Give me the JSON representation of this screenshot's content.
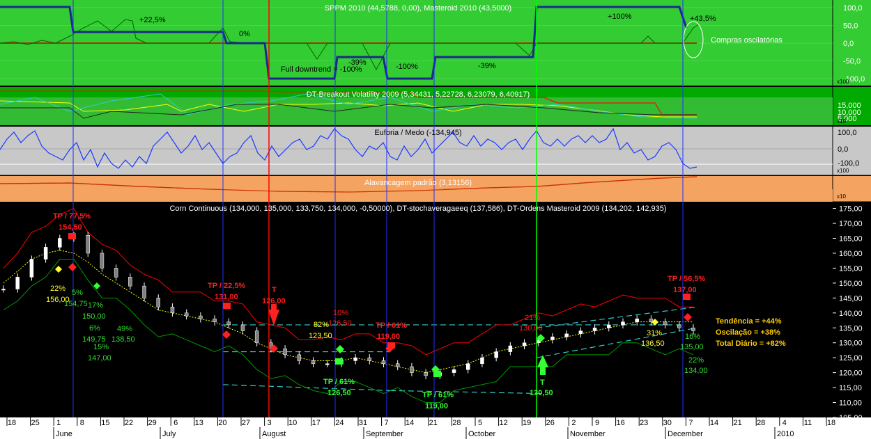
{
  "panels": {
    "sppm": {
      "title": "SPPM 2010 (44,5788, 0,00), Masteroid 2010 (43,5000)",
      "ticks": [
        "100,0",
        "50,0",
        "0,0",
        "-50,0",
        "-100,0"
      ],
      "tick_values": [
        100,
        50,
        0,
        -50,
        -100
      ],
      "scale": "x100",
      "annotations": [
        "+22,5%",
        "0%",
        "Full downtrend = -100%",
        "-39%",
        "-100%",
        "-39%",
        "+100%",
        "+43,5%",
        "Compras oscilatórias"
      ]
    },
    "breakout": {
      "title": "DT-Breakout Volatility 2009 (5,34431, 5,22728, 6,23079, 6,40917)",
      "ticks": [
        "15,000",
        "10,000",
        "5,000"
      ],
      "scale": "x10"
    },
    "euforia": {
      "title": "Euforia / Medo (-134,945)",
      "ticks": [
        "100,0",
        "0,0",
        "-100,0"
      ],
      "scale": "x100"
    },
    "alavancagem": {
      "title": "Alavancagem padrão (3,13156)",
      "scale": "x10"
    },
    "main": {
      "title": "Corn Continuous (134,000, 135,000, 133,750, 134,000, -0,50000), DT-stochaveragaeeq (137,586), DT-Ordens Masteroid 2009 (134,202, 142,935)",
      "ticks": [
        "175,00",
        "170,00",
        "165,00",
        "160,00",
        "155,00",
        "150,00",
        "145,00",
        "140,00",
        "135,00",
        "130,00",
        "125,00",
        "120,00",
        "115,00",
        "110,00",
        "105,00"
      ],
      "scale": "x100",
      "summary": {
        "tendencia": "Tendência = +44%",
        "oscilacao": "Oscilação = +38%",
        "total": "Total Diário = +82%"
      },
      "labels": {
        "tp775": "TP / 77,5%",
        "p15450": "154,50",
        "tp225": "TP / 22,5%",
        "p13100": "131,00",
        "t1": "T",
        "p12600": "126,00",
        "tp61a": "TP / 61%",
        "p11900a": "119,00",
        "tp565": "TP / 56,5%",
        "p13700": "137,00",
        "pct22": "22%",
        "p15600": "156,00",
        "pct5": "5%",
        "p15475": "154,75",
        "pct17": "17%",
        "p15000": "150,00",
        "pct6": "6%",
        "p14975": "149,75",
        "pct49": "49%",
        "p13850": "138,50",
        "pct15": "15%",
        "p14700": "147,00",
        "pct10": "10%",
        "p12650r": "126,50",
        "pct82": "82%",
        "p12350": "123,50",
        "tp61b": "TP / 61%",
        "p12650g": "126,50",
        "tp61c": "TP / 61%",
        "p11900b": "119,00",
        "pct21": "21%",
        "p13000": "130,00",
        "t2": "T",
        "p13050": "130,50",
        "pct31": "31%",
        "p13650": "136,50",
        "pct16": "16%",
        "p13500": "135,00",
        "pct22b": "22%",
        "p13400": "134,00"
      }
    }
  },
  "x_axis": {
    "days": [
      "18",
      "25",
      "1",
      "8",
      "15",
      "22",
      "29",
      "6",
      "13",
      "20",
      "27",
      "3",
      "10",
      "17",
      "24",
      "31",
      "7",
      "14",
      "21",
      "28",
      "5",
      "12",
      "19",
      "26",
      "2",
      "9",
      "16",
      "23",
      "30",
      "7",
      "14",
      "21",
      "28",
      "4",
      "11",
      "18"
    ],
    "months": [
      "June",
      "July",
      "August",
      "September",
      "October",
      "November",
      "December",
      "2010"
    ],
    "scale": "x100"
  },
  "chart_data": {
    "type": "line",
    "title": "Corn Continuous (134,000, 135,000, 133,750, 134,000, -0,50000)",
    "ylim": [
      105,
      177
    ],
    "x_start": "2009-05-18",
    "x_end": "2010-01-18",
    "series": [
      {
        "name": "Corn Continuous",
        "values": [
          148,
          152,
          158,
          162,
          165,
          166,
          160,
          155,
          152,
          149,
          145,
          142,
          140,
          139,
          138,
          137,
          136,
          134,
          130,
          128,
          126,
          124,
          123,
          123,
          124,
          125,
          124,
          123,
          122,
          120,
          119,
          120,
          121,
          123,
          125,
          127,
          129,
          130,
          131,
          132,
          133,
          134,
          135,
          136,
          137,
          138,
          137,
          136,
          135,
          134
        ]
      },
      {
        "name": "DT-stochaveragaeeq",
        "values": [
          150,
          154,
          158,
          160,
          161,
          160,
          157,
          153,
          150,
          147,
          144,
          141,
          140,
          139,
          138,
          137,
          135,
          133,
          130,
          128,
          126,
          125,
          124,
          124,
          124,
          125,
          124,
          123,
          122,
          121,
          120,
          121,
          122,
          123,
          125,
          127,
          128,
          129,
          130,
          131,
          132,
          133,
          134,
          135,
          136,
          137,
          137,
          137,
          137,
          137
        ]
      }
    ],
    "colors": {
      "up": "#ffffff",
      "down": "#808080",
      "upper_band": "#ff0000",
      "lower_band": "#009900",
      "stoch": "#ffff00",
      "channel": "#33cccc",
      "vline_blue": "#2030ff",
      "vline_red": "#ff0000",
      "vline_green": "#00ff00"
    }
  }
}
